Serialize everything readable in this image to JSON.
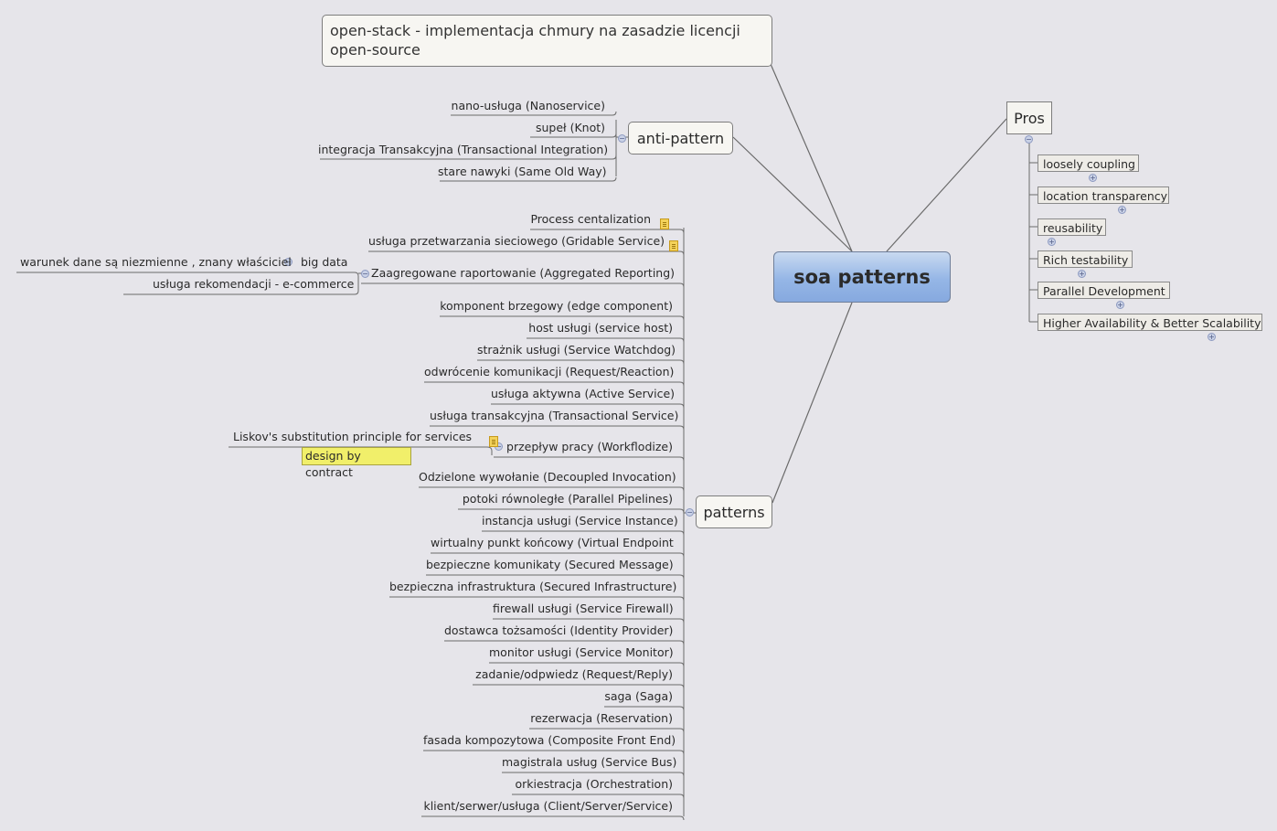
{
  "root": {
    "label": "soa patterns"
  },
  "openstack": {
    "label": "open-stack - implementacja chmury na zasadzie licencji open-source"
  },
  "anti_pattern": {
    "label": "anti-pattern",
    "children": [
      "nano-usługa (Nanoservice)",
      "supeł (Knot)",
      "integracja Transakcyjna (Transactional Integration)",
      "stare nawyki (Same Old Way)"
    ]
  },
  "pros": {
    "label": "Pros",
    "children": [
      "loosely coupling",
      "location transparency",
      "reusability",
      "Rich testability",
      "Parallel Development",
      "Higher Availability & Better Scalability"
    ]
  },
  "patterns": {
    "label": "patterns",
    "children": [
      {
        "label": "Process centalization",
        "note": true
      },
      {
        "label": "usługa przetwarzania sieciowego (Gridable Service)",
        "note": true
      },
      {
        "label": "Zaagregowane raportowanie (Aggregated Reporting)",
        "children": [
          {
            "label": "big data",
            "children": [
              "warunek dane są niezmienne , znany właściciel"
            ]
          },
          {
            "label": "usługa rekomendacji - e-commerce"
          }
        ]
      },
      {
        "label": "komponent brzegowy (edge component)"
      },
      {
        "label": "host usługi (service host)"
      },
      {
        "label": "strażnik usługi (Service Watchdog)"
      },
      {
        "label": "odwrócenie komunikacji (Request/Reaction)"
      },
      {
        "label": "usługa aktywna (Active Service)"
      },
      {
        "label": "usługa transakcyjna (Transactional Service)"
      },
      {
        "label": "przepływ pracy (Workflodize)",
        "children": [
          {
            "label": "Liskov's substitution principle for services",
            "note": true
          },
          {
            "label": "design by contract",
            "highlight": "#f1ef6a"
          }
        ]
      },
      {
        "label": "Odzielone wywołanie (Decoupled Invocation)"
      },
      {
        "label": "potoki równoległe (Parallel Pipelines)"
      },
      {
        "label": "instancja usługi (Service Instance)"
      },
      {
        "label": "wirtualny punkt końcowy (Virtual Endpoint"
      },
      {
        "label": "bezpieczne komunikaty  (Secured Message)"
      },
      {
        "label": "bezpieczna infrastruktura (Secured Infrastructure)"
      },
      {
        "label": "firewall usługi (Service Firewall)"
      },
      {
        "label": "dostawca tożsamości (Identity Provider)"
      },
      {
        "label": "monitor usługi (Service Monitor)"
      },
      {
        "label": "zadanie/odpwiedz (Request/Reply)"
      },
      {
        "label": "saga (Saga)"
      },
      {
        "label": "rezerwacja (Reservation)"
      },
      {
        "label": "fasada kompozytowa (Composite Front End)"
      },
      {
        "label": "magistrala usług (Service Bus)"
      },
      {
        "label": "orkiestracja (Orchestration)"
      },
      {
        "label": "klient/serwer/usługa (Client/Server/Service)"
      }
    ]
  },
  "icons": {
    "collapse": "−",
    "expand": "+",
    "note": "note-icon"
  },
  "colors": {
    "background": "#e6e5ea",
    "root_fill": "#95b6e6",
    "highlight": "#f1ef6a",
    "note": "#f3d25a"
  }
}
